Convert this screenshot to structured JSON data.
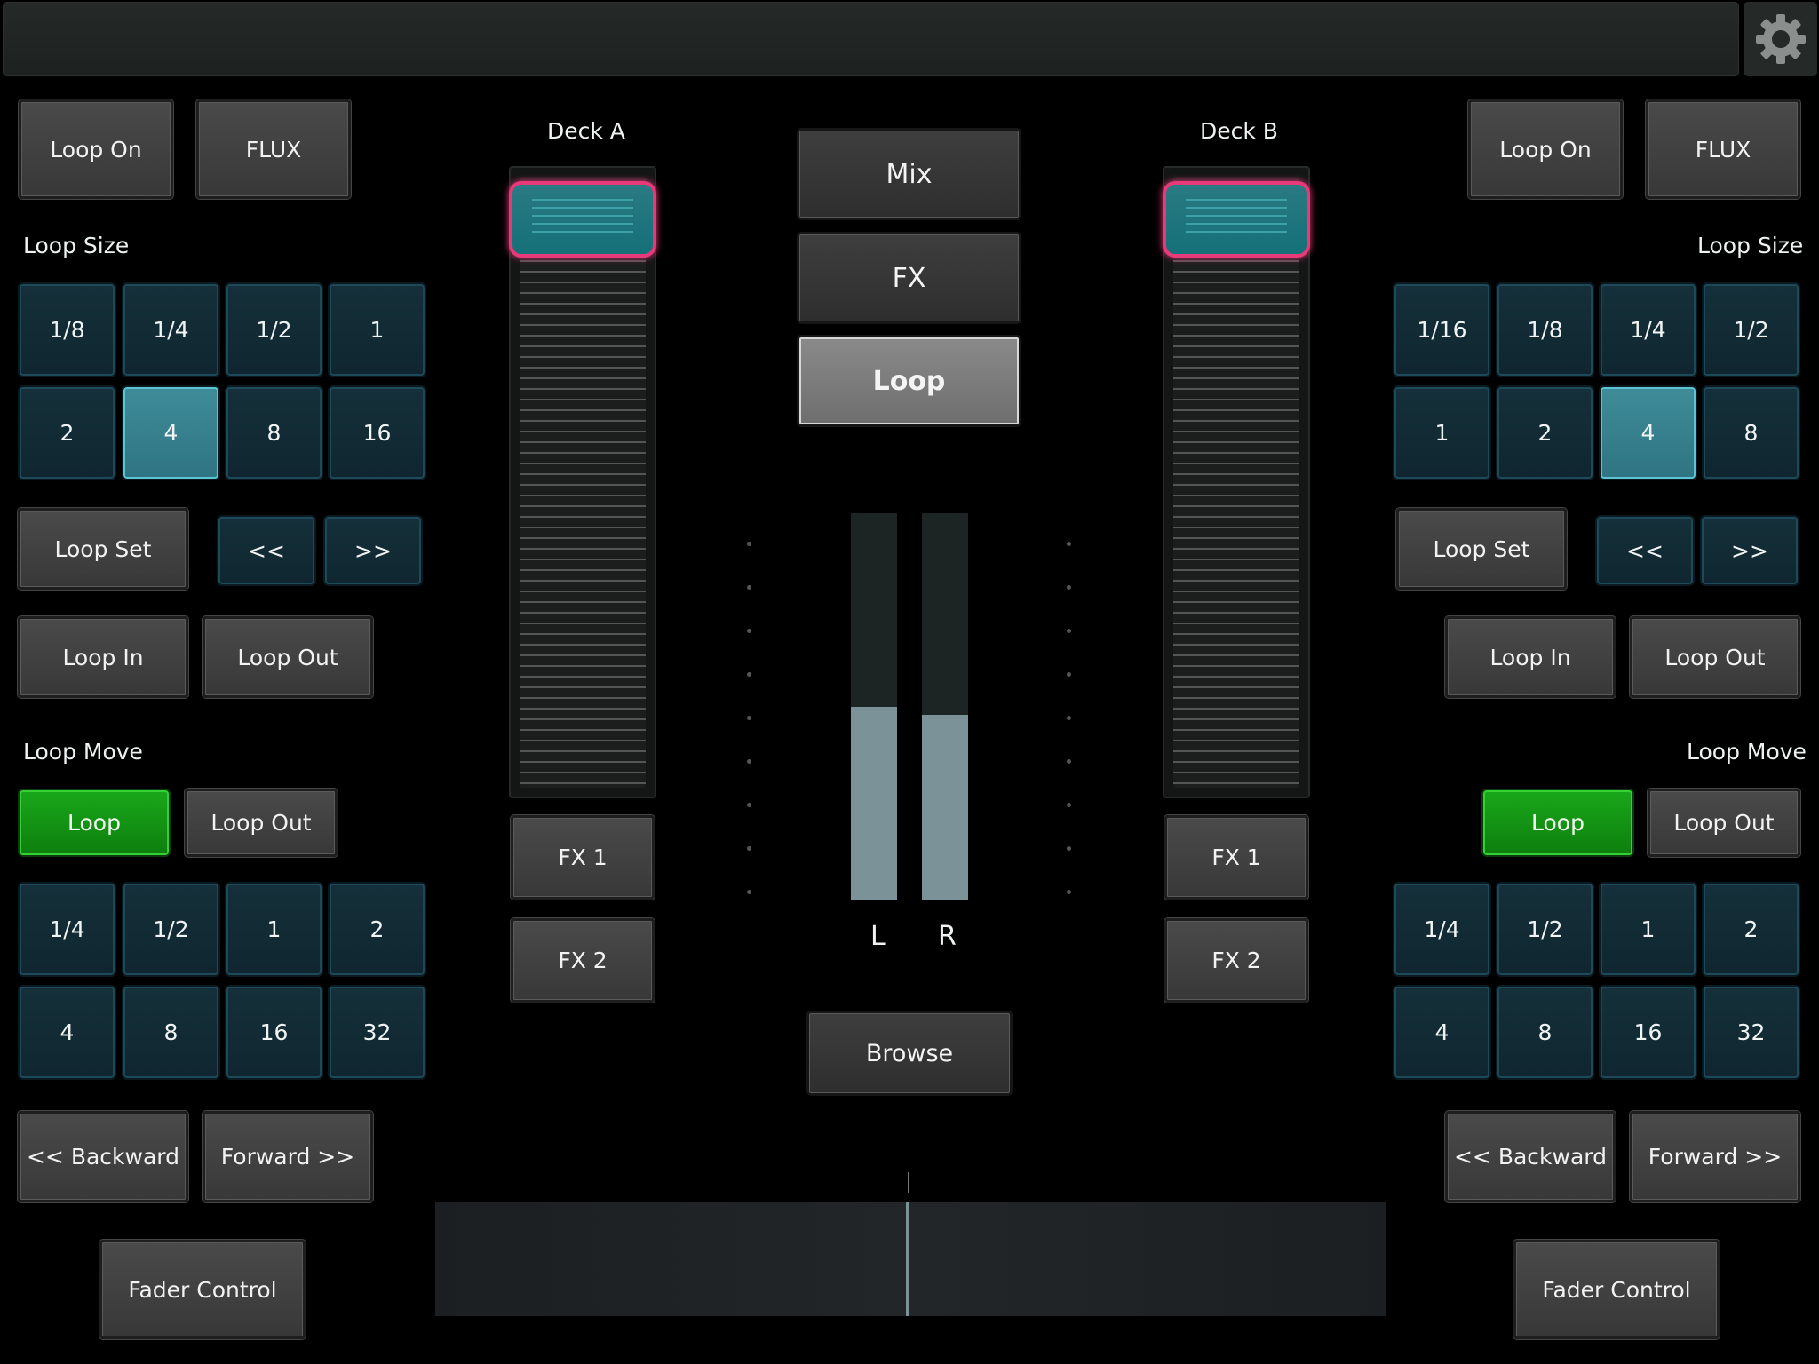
{
  "left": {
    "loop_on": "Loop On",
    "flux": "FLUX",
    "loop_size_label": "Loop Size",
    "loop_sizes": [
      "1/8",
      "1/4",
      "1/2",
      "1",
      "2",
      "4",
      "8",
      "16"
    ],
    "loop_set": "Loop Set",
    "prev": "<<",
    "next": ">>",
    "loop_in": "Loop In",
    "loop_out": "Loop Out",
    "loop_move_label": "Loop Move",
    "move_loop": "Loop",
    "move_loop_out": "Loop Out",
    "move_sizes": [
      "1/4",
      "1/2",
      "1",
      "2",
      "4",
      "8",
      "16",
      "32"
    ],
    "backward": "<<  Backward",
    "forward": "Forward    >>",
    "fader_control": "Fader Control"
  },
  "right": {
    "loop_on": "Loop On",
    "flux": "FLUX",
    "loop_size_label": "Loop Size",
    "loop_sizes": [
      "1/16",
      "1/8",
      "1/4",
      "1/2",
      "1",
      "2",
      "4",
      "8"
    ],
    "loop_set": "Loop Set",
    "prev": "<<",
    "next": ">>",
    "loop_in": "Loop In",
    "loop_out": "Loop Out",
    "loop_move_label": "Loop Move",
    "move_loop": "Loop",
    "move_loop_out": "Loop Out",
    "move_sizes": [
      "1/4",
      "1/2",
      "1",
      "2",
      "4",
      "8",
      "16",
      "32"
    ],
    "backward": "<<  Backward",
    "forward": "Forward    >>",
    "fader_control": "Fader Control"
  },
  "deck_a": {
    "title": "Deck A",
    "fx1": "FX 1",
    "fx2": "FX 2"
  },
  "deck_b": {
    "title": "Deck B",
    "fx1": "FX 1",
    "fx2": "FX 2"
  },
  "center": {
    "mix": "Mix",
    "fx": "FX",
    "loop": "Loop",
    "browse": "Browse",
    "meter_l": "L",
    "meter_r": "R"
  },
  "levels": {
    "left_meter_fraction": 0.5,
    "right_meter_fraction": 0.48
  },
  "colors": {
    "accent_teal": "#2f7482",
    "active_green": "#1aa81a",
    "fader_knob_border": "#e83a78"
  },
  "icons": {
    "settings": "gear-icon"
  }
}
